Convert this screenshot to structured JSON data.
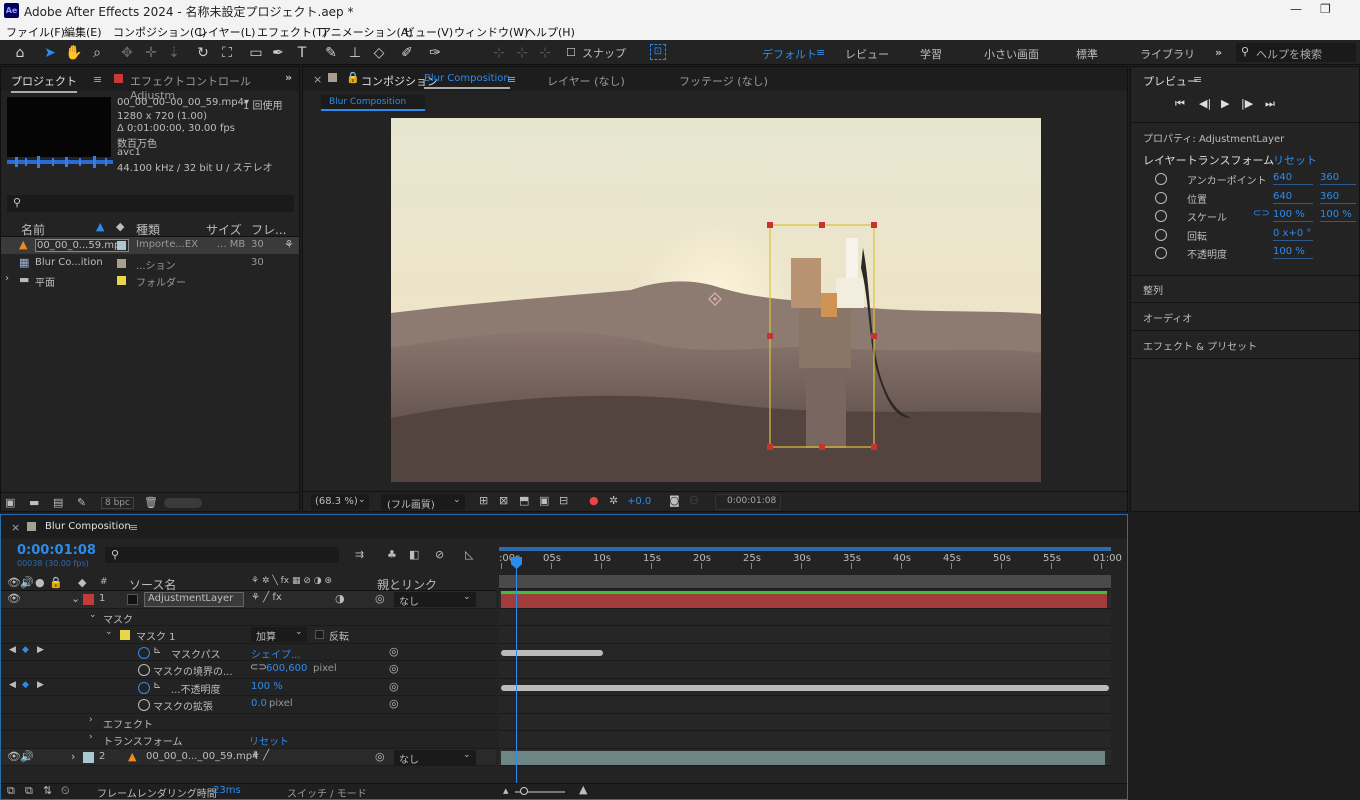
{
  "window": {
    "title": "Adobe After Effects 2024 - 名称未設定プロジェクト.aep *",
    "app_icon": "Ae"
  },
  "menu": [
    "ファイル(F)",
    "編集(E)",
    "コンポジション(C)",
    "レイヤー(L)",
    "エフェクト(T)",
    "アニメーション(A)",
    "ビュー(V)",
    "ウィンドウ(W)",
    "ヘルプ(H)"
  ],
  "toolbar": {
    "snap_label": "スナップ",
    "workspaces": [
      "デフォルト",
      "レビュー",
      "学習",
      "小さい画面",
      "標準",
      "ライブラリ"
    ],
    "active_workspace": "デフォルト",
    "search_placeholder": "ヘルプを検索"
  },
  "project": {
    "tab_project": "プロジェクト",
    "tab_effects": "エフェクトコントロール Adjustm",
    "file_name": "00_00_00–00_00_59.mp4▾",
    "usage": "1 回使用",
    "info": [
      "1280 x 720 (1.00)",
      "Δ 0;01:00:00, 30.00 fps",
      "数百万色",
      "avc1",
      "44.100 kHz / 32 bit U / ステレオ"
    ],
    "headers": {
      "name": "名前",
      "type": "種類",
      "size": "サイズ",
      "fr": "フレ..."
    },
    "items": [
      {
        "name": "00_00_0...59.mp4",
        "type": "Importe...EX",
        "size": "... MB",
        "fr": "30",
        "color": "#a9c8cf",
        "icon": "vlc-cone-icon"
      },
      {
        "name": "Blur Co...ition",
        "type": "...ション",
        "size": "",
        "fr": "30",
        "color": "#a99f8e",
        "icon": "composition-icon"
      },
      {
        "name": "平面",
        "type": "フォルダー",
        "size": "",
        "fr": "",
        "color": "#e8d64a",
        "icon": "folder-icon"
      }
    ],
    "bpc": "8 bpc"
  },
  "comp": {
    "tab_label": "コンポジション",
    "tab_name": "Blur Composition",
    "tab_layer": "レイヤー (なし)",
    "tab_footage": "フッテージ (なし)",
    "breadcrumb": "Blur Composition",
    "zoom": "(68.3 %)",
    "quality": "(フル画質)",
    "exposure": "+0.0",
    "timecode": "0:00:01:08"
  },
  "right": {
    "preview_title": "プレビュー",
    "properties_title": "プロパティ: AdjustmentLayer",
    "transform_title": "レイヤートランスフォーム",
    "reset": "リセット",
    "props": [
      {
        "name": "アンカーポイント",
        "v1": "640",
        "v2": "360"
      },
      {
        "name": "位置",
        "v1": "640",
        "v2": "360"
      },
      {
        "name": "スケール",
        "v1": "100 %",
        "v2": "100 %"
      },
      {
        "name": "回転",
        "v1": "0 x+0 °",
        "v2": ""
      },
      {
        "name": "不透明度",
        "v1": "100 %",
        "v2": ""
      }
    ],
    "sections": [
      "整列",
      "オーディオ",
      "エフェクト & プリセット"
    ]
  },
  "timeline": {
    "tab": "Blur Composition",
    "timecode": "0:00:01:08",
    "frames": "00038 (30.00 fps)",
    "col_source": "ソース名",
    "col_parent": "親とリンク",
    "ruler": [
      ":00s",
      "05s",
      "10s",
      "15s",
      "20s",
      "25s",
      "30s",
      "35s",
      "40s",
      "45s",
      "50s",
      "55s",
      "01:00"
    ],
    "layer1": {
      "num": "1",
      "name": "AdjustmentLayer",
      "parent": "なし"
    },
    "mask": "マスク",
    "mask1": "マスク 1",
    "mode": "加算",
    "invert": "反転",
    "mask_path": "マスクパス",
    "shape": "シェイプ...",
    "feather": "マスクの境界の...",
    "feather_val": "600,600",
    "feather_unit": "pixel",
    "opacity": "...不透明度",
    "opacity_val": "100 %",
    "expansion": "マスクの拡張",
    "expansion_val": "0.0",
    "expansion_unit": "pixel",
    "effect": "エフェクト",
    "transform": "トランスフォーム",
    "transform_reset": "リセット",
    "layer2": {
      "num": "2",
      "name": "00_00_0..._00_59.mp4",
      "parent": "なし"
    },
    "render_label": "フレームレンダリング時間",
    "render_val": "23ms",
    "switch_label": "スイッチ / モード"
  }
}
